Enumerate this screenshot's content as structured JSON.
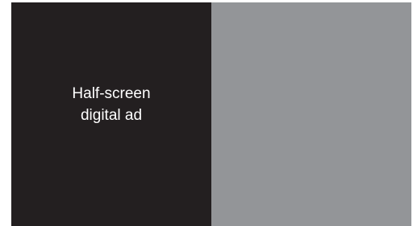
{
  "ad_panel": {
    "label_line1": "Half-screen",
    "label_line2": "digital ad",
    "background": "#231f20",
    "text_color": "#ffffff"
  },
  "content_panel": {
    "background": "#939598"
  }
}
